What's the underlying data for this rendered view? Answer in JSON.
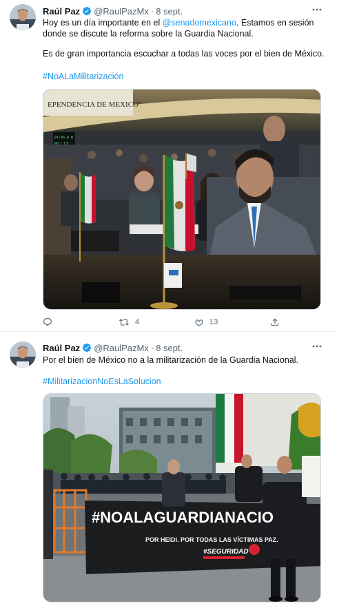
{
  "tweets": [
    {
      "author_name": "Raúl Paz",
      "handle": "@RaulPazMx",
      "separator": "·",
      "date": "8 sept.",
      "text_part1": "Hoy es un día importante en el ",
      "mention": "@senadomexicano",
      "text_part2": ". Estamos en sesión donde se discute la reforma sobre la Guardia Nacional.",
      "paragraph2": "Es de gran importancia escuchar a todas las voces por el bien de México.",
      "hashtag": "#NoALaMilitarización",
      "image_sign_text": "EPENDENCIA DE MEXICO\"",
      "image_clock_time": "01:46 p.m.",
      "image_clock_count": "01:11",
      "actions": {
        "reply_count": "",
        "retweet_count": "4",
        "like_count": "13"
      }
    },
    {
      "author_name": "Raúl Paz",
      "handle": "@RaulPazMx",
      "separator": "·",
      "date": "8 sept.",
      "text": "Por el bien de México no a la militarización de la Guardia Nacional.",
      "hashtag": "#MilitarizacionNoEsLaSolucion",
      "banner_main": "#NOALAGUARDIANACIO",
      "banner_sub": "POR HEIDI. POR TODAS LAS VÍCTIMAS      PAZ.",
      "banner_tag": "#SEGURIDAD"
    }
  ],
  "colors": {
    "link": "#1d9bf0",
    "secondary_text": "#536471",
    "verified": "#1d9bf0"
  },
  "icons": {
    "more": "more-icon",
    "verified": "verified-badge-icon",
    "reply": "reply-icon",
    "retweet": "retweet-icon",
    "like": "like-icon",
    "share": "share-icon"
  }
}
